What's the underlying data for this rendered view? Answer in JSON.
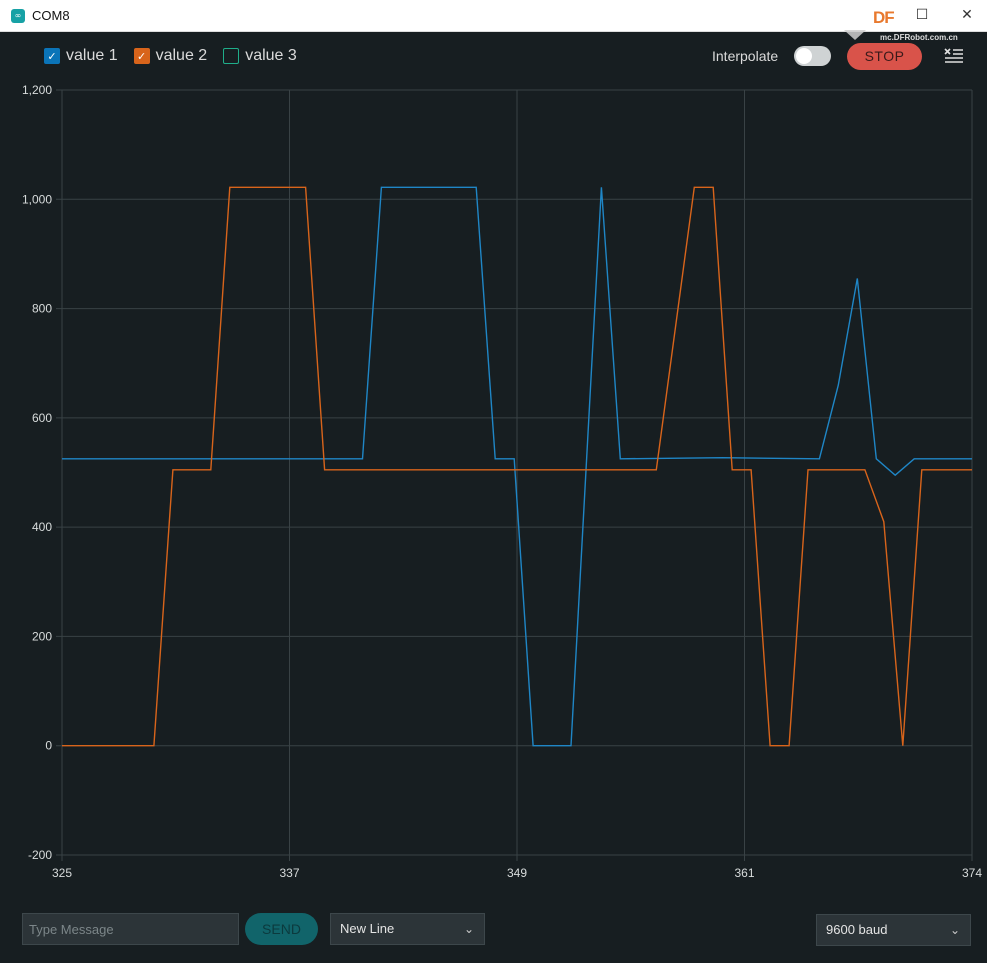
{
  "window": {
    "title": "COM8",
    "app_icon": "arduino-infinity-icon",
    "minimize": "–",
    "maximize": "☐",
    "close": "✕",
    "overlay_logo": "DF",
    "watermark": "mc.DFRobot.com.cn"
  },
  "toolbar": {
    "legend": [
      {
        "label": "value 1",
        "checked": true,
        "color": "#0b74b8"
      },
      {
        "label": "value 2",
        "checked": true,
        "color": "#d8641b"
      },
      {
        "label": "value 3",
        "checked": false,
        "color": "#1fae8a"
      }
    ],
    "interpolate_label": "Interpolate",
    "interpolate_on": false,
    "stop_label": "STOP",
    "menu_icon": "clear-list-icon"
  },
  "chart_data": {
    "type": "line",
    "title": "",
    "xlabel": "",
    "ylabel": "",
    "xlim": [
      325.15,
      373.15
    ],
    "ylim": [
      -200,
      1200
    ],
    "grid": true,
    "x_ticks": [
      325,
      337,
      349,
      361,
      374
    ],
    "y_ticks": [
      1200,
      1000,
      800,
      600,
      400,
      200,
      0,
      -200
    ],
    "y_tick_labels": [
      "1,200",
      "1,000",
      "800",
      "600",
      "400",
      "200",
      "0",
      "-200"
    ],
    "series": [
      {
        "name": "value 1",
        "color": "#1f86c6",
        "points": [
          [
            325.15,
            525
          ],
          [
            341,
            525
          ],
          [
            342,
            1022
          ],
          [
            347,
            1022
          ],
          [
            348,
            525
          ],
          [
            349,
            525
          ],
          [
            350,
            0
          ],
          [
            352,
            0
          ],
          [
            353.6,
            1022
          ],
          [
            354.6,
            525
          ],
          [
            360,
            527
          ],
          [
            365.1,
            525
          ],
          [
            366.1,
            660
          ],
          [
            367.1,
            855
          ],
          [
            368.1,
            525
          ],
          [
            369.1,
            495
          ],
          [
            370.1,
            525
          ],
          [
            373.15,
            525
          ]
        ]
      },
      {
        "name": "value 2",
        "color": "#d8641b",
        "points": [
          [
            325.15,
            0
          ],
          [
            330,
            0
          ],
          [
            331,
            505
          ],
          [
            333,
            505
          ],
          [
            334,
            1022
          ],
          [
            338,
            1022
          ],
          [
            339,
            505
          ],
          [
            356.5,
            505
          ],
          [
            358.5,
            1022
          ],
          [
            359.5,
            1022
          ],
          [
            360.5,
            505
          ],
          [
            361.5,
            505
          ],
          [
            362.5,
            0
          ],
          [
            363.5,
            0
          ],
          [
            364.5,
            505
          ],
          [
            367.5,
            505
          ],
          [
            368.5,
            410
          ],
          [
            369.5,
            0
          ],
          [
            370.5,
            505
          ],
          [
            373.15,
            505
          ]
        ]
      },
      {
        "name": "value 3",
        "color": "#1fae8a",
        "points": []
      }
    ]
  },
  "footer": {
    "message_placeholder": "Type Message",
    "message_value": "",
    "send_label": "SEND",
    "line_ending": "New Line",
    "baud_rate": "9600 baud",
    "chevron": "⌄"
  }
}
